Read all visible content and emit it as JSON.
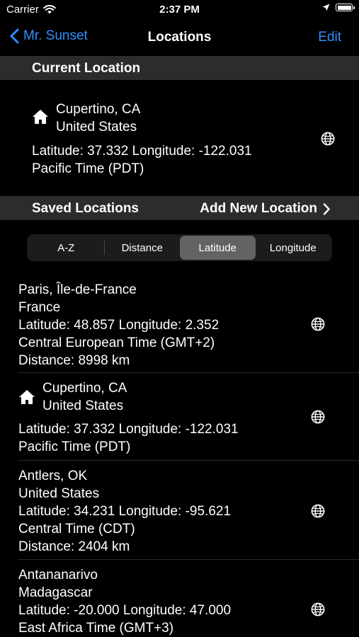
{
  "status_bar": {
    "carrier": "Carrier",
    "time": "2:37 PM"
  },
  "nav": {
    "back_label": "Mr. Sunset",
    "title": "Locations",
    "edit_label": "Edit"
  },
  "current_section": {
    "header": "Current Location"
  },
  "current_location": {
    "city": "Cupertino, CA",
    "country": "United States",
    "coords": "Latitude: 37.332  Longitude: -122.031",
    "timezone": "Pacific Time (PDT)"
  },
  "saved_section": {
    "header": "Saved Locations",
    "add_label": "Add New Location"
  },
  "sort": {
    "options": [
      "A-Z",
      "Distance",
      "Latitude",
      "Longitude"
    ],
    "selected": "Latitude"
  },
  "saved_locations": [
    {
      "line1": "Paris, Île-de-France",
      "line2": "France",
      "coords": "Latitude: 48.857  Longitude: 2.352",
      "timezone": "Central European Time (GMT+2)",
      "distance": "Distance: 8998 km"
    },
    {
      "line1": "Cupertino, CA",
      "line2": "United States",
      "coords": "Latitude: 37.332  Longitude: -122.031",
      "timezone": "Pacific Time (PDT)",
      "is_home": true
    },
    {
      "line1": "Antlers, OK",
      "line2": "United States",
      "coords": "Latitude: 34.231  Longitude: -95.621",
      "timezone": "Central Time (CDT)",
      "distance": "Distance: 2404 km"
    },
    {
      "line1": "Antananarivo",
      "line2": "Madagascar",
      "coords": "Latitude: -20.000  Longitude: 47.000",
      "timezone": "East Africa Time (GMT+3)"
    }
  ],
  "colors": {
    "accent": "#2f8fff",
    "section_bg": "#2c2c2e",
    "segment_active": "#636366"
  }
}
